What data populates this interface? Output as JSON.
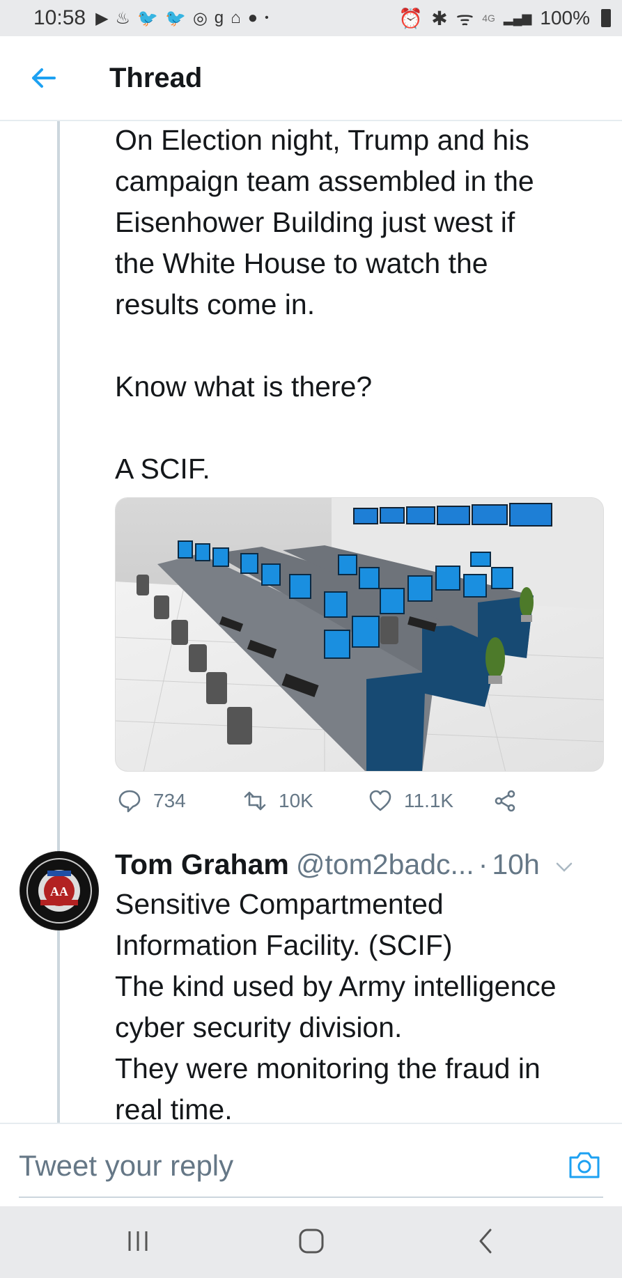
{
  "status_bar": {
    "time": "10:58",
    "network": "4G",
    "battery": "100%"
  },
  "header": {
    "title": "Thread",
    "back_icon": "arrow-left-icon"
  },
  "tweet": {
    "text": "On Election night, Trump and his\ncampaign team assembled in the\nEisenhower Building just west if\nthe White House to watch the\nresults come in.\n\nKnow what is there?\n\nA SCIF.",
    "media_description_icon": "image",
    "stats": {
      "replies": "734",
      "retweets": "10K",
      "likes": "11.1K"
    }
  },
  "reply": {
    "name": "Tom Graham",
    "handle": "@tom2badc...",
    "separator": "·",
    "time": "10h",
    "text": "Sensitive Compartmented\nInformation Facility. (SCIF)\nThe kind used by Army intelligence\ncyber security division.\nThey were monitoring the fraud in\nreal time."
  },
  "composer": {
    "placeholder": "Tweet your reply"
  },
  "colors": {
    "accent": "#1da1f2",
    "secondary_text": "#657786",
    "primary_text": "#14171a"
  }
}
